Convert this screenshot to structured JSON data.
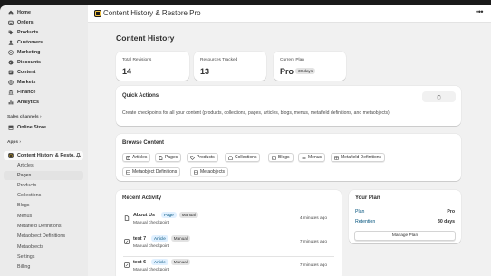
{
  "nav": {
    "items": [
      {
        "label": "Home",
        "icon": "home-icon"
      },
      {
        "label": "Orders",
        "icon": "orders-icon"
      },
      {
        "label": "Products",
        "icon": "tag-icon"
      },
      {
        "label": "Customers",
        "icon": "person-icon"
      },
      {
        "label": "Marketing",
        "icon": "target-icon"
      },
      {
        "label": "Discounts",
        "icon": "discount-icon"
      },
      {
        "label": "Content",
        "icon": "content-icon"
      },
      {
        "label": "Markets",
        "icon": "globe-icon"
      },
      {
        "label": "Finance",
        "icon": "bank-icon"
      },
      {
        "label": "Analytics",
        "icon": "chart-icon"
      }
    ],
    "sales_channels_label": "Sales channels",
    "online_store_label": "Online Store",
    "apps_label": "Apps",
    "app_name": "Content History & Resto...",
    "app_subitems": [
      "Articles",
      "Pages",
      "Products",
      "Collections",
      "Blogs",
      "Menus",
      "Metafield Definitions",
      "Metaobject Definitions",
      "Metaobjects",
      "Settings",
      "Billing"
    ],
    "active_subitem": "Pages"
  },
  "appbar": {
    "title": "Content History & Restore Pro",
    "menu_icon": "more-horizontal-icon"
  },
  "page": {
    "title": "Content History"
  },
  "stats": [
    {
      "label": "Total Revisions",
      "value": "14"
    },
    {
      "label": "Resources Tracked",
      "value": "13"
    },
    {
      "label": "Current Plan",
      "value": "Pro",
      "badge": "30 days"
    }
  ],
  "quick_actions": {
    "title": "Quick Actions",
    "description": "Create checkpoints for all your content (products, collections, pages, articles, blogs, menus, metafield definitions, and metaobjects)."
  },
  "browse": {
    "title": "Browse Content",
    "chips": [
      {
        "label": "Articles",
        "icon": "article-icon"
      },
      {
        "label": "Pages",
        "icon": "page-icon"
      },
      {
        "label": "Products",
        "icon": "tag-icon"
      },
      {
        "label": "Collections",
        "icon": "collection-icon"
      },
      {
        "label": "Blogs",
        "icon": "blog-icon"
      },
      {
        "label": "Menus",
        "icon": "menu-icon"
      },
      {
        "label": "Metafield Definitions",
        "icon": "metafield-icon"
      },
      {
        "label": "Metaobject Definitions",
        "icon": "metaobject-icon"
      },
      {
        "label": "Metaobjects",
        "icon": "metaobject-icon"
      }
    ]
  },
  "activity": {
    "title": "Recent Activity",
    "rows": [
      {
        "name": "About Us",
        "type": "Page",
        "kind": "Manual",
        "sub": "Manual checkpoint",
        "time": "4 minutes ago",
        "icon": "page-icon"
      },
      {
        "name": "test 7",
        "type": "Article",
        "kind": "Manual",
        "sub": "Manual checkpoint",
        "time": "7 minutes ago",
        "icon": "article-icon"
      },
      {
        "name": "test 6",
        "type": "Article",
        "kind": "Manual",
        "sub": "Manual checkpoint",
        "time": "7 minutes ago",
        "icon": "article-icon"
      }
    ]
  },
  "plan": {
    "title": "Your Plan",
    "plan_label": "Plan",
    "plan_value": "Pro",
    "retention_label": "Retention",
    "retention_value": "30 days",
    "button": "Manage Plan"
  }
}
